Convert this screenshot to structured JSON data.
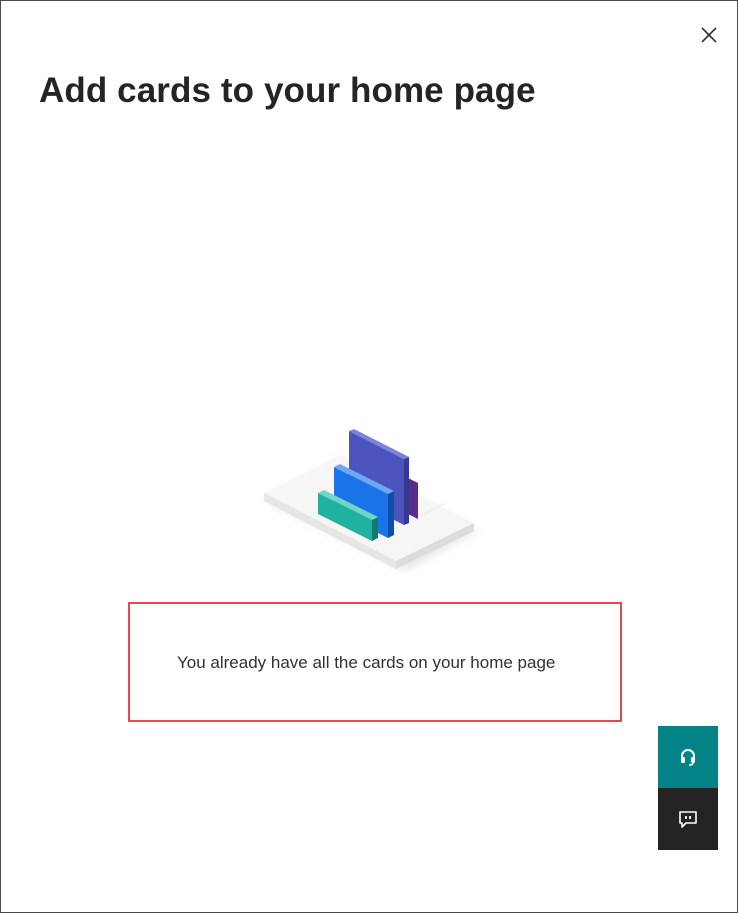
{
  "dialog": {
    "title": "Add cards to your home page",
    "close_icon": "close-icon"
  },
  "illustration": {
    "icon": "cards-illustration",
    "colors": {
      "tall_card": "#4b53bc",
      "blue_card": "#1a73e8",
      "teal_card": "#20b2a0",
      "purple_card": "#7b3fa0"
    }
  },
  "message": {
    "text": "You already have all the cards on your home page",
    "highlight_color": "#e8474f"
  },
  "side_buttons": {
    "support": {
      "icon": "headset-icon",
      "color": "#038387"
    },
    "feedback": {
      "icon": "feedback-icon",
      "color": "#252423"
    }
  }
}
